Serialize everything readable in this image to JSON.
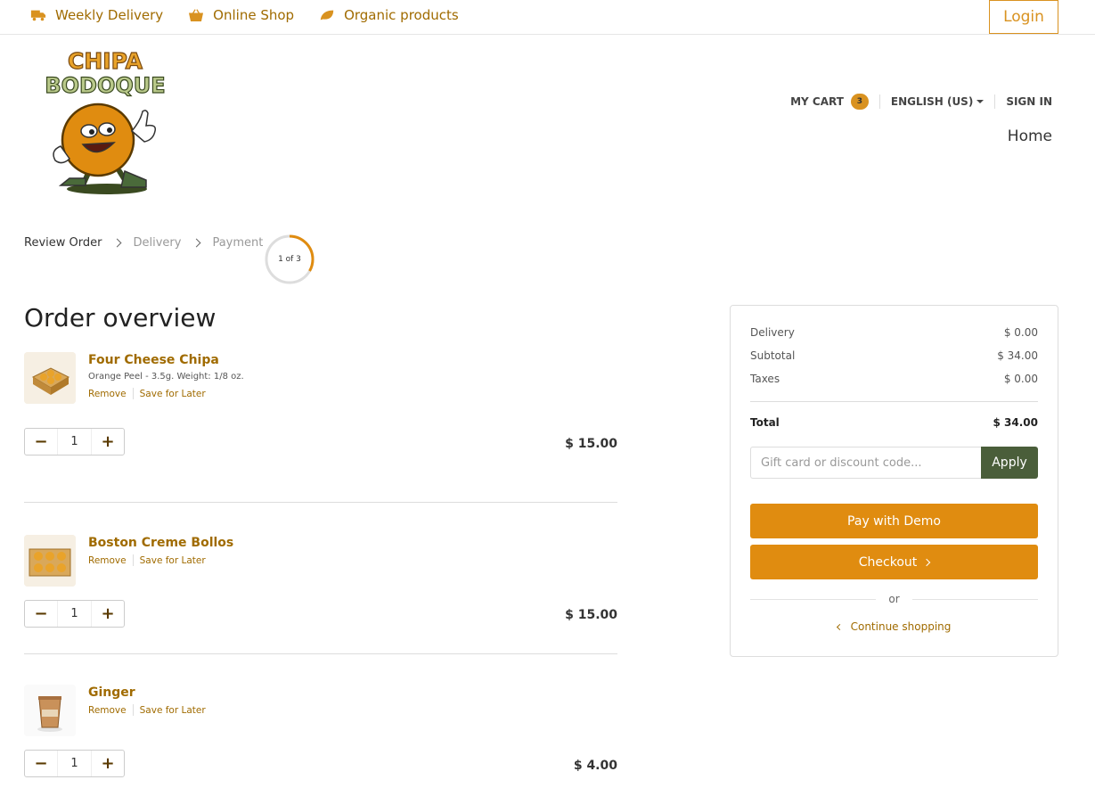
{
  "topnav": {
    "items": [
      {
        "label": "Weekly Delivery",
        "icon": "truck-icon"
      },
      {
        "label": "Online Shop",
        "icon": "basket-icon"
      },
      {
        "label": "Organic products",
        "icon": "leaf-icon"
      }
    ],
    "login_label": "Login"
  },
  "logo": {
    "line1": "CHIPA",
    "line2": "BODOQUE"
  },
  "header": {
    "cart_label": "MY CART",
    "cart_count": "3",
    "language": "ENGLISH (US)",
    "signin_label": "SIGN IN",
    "home_label": "Home"
  },
  "steps": {
    "items": [
      "Review Order",
      "Delivery",
      "Payment"
    ],
    "progress_label": "1 of 3",
    "progress_fraction": 0.333
  },
  "order": {
    "title": "Order overview",
    "items": [
      {
        "name": "Four Cheese Chipa",
        "desc": "Orange Peel - 3.5g. Weight: 1/8 oz.",
        "remove": "Remove",
        "save": "Save for Later",
        "qty": "1",
        "price": "$ 15.00"
      },
      {
        "name": "Boston Creme Bollos",
        "desc": "",
        "remove": "Remove",
        "save": "Save for Later",
        "qty": "1",
        "price": "$ 15.00"
      },
      {
        "name": "Ginger",
        "desc": "",
        "remove": "Remove",
        "save": "Save for Later",
        "qty": "1",
        "price": "$ 4.00"
      }
    ]
  },
  "summary": {
    "delivery_label": "Delivery",
    "delivery_value": "$ 0.00",
    "subtotal_label": "Subtotal",
    "subtotal_value": "$ 34.00",
    "taxes_label": "Taxes",
    "taxes_value": "$ 0.00",
    "total_label": "Total",
    "total_value": "$ 34.00",
    "discount_placeholder": "Gift card or discount code...",
    "apply_label": "Apply",
    "pay_label": "Pay with Demo",
    "checkout_label": "Checkout",
    "or_label": "or",
    "continue_label": "Continue shopping"
  },
  "colors": {
    "accent": "#e08c10",
    "brand_text": "#a06b00",
    "apply_bg": "#4a5e3a"
  }
}
